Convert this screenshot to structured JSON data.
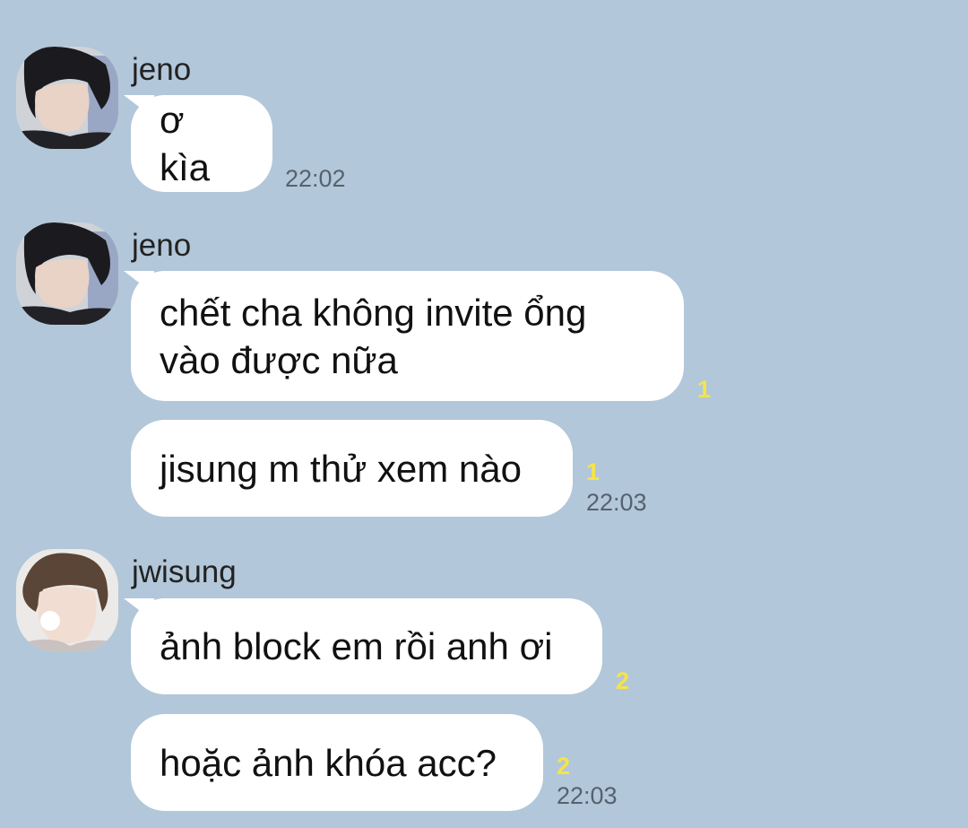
{
  "colors": {
    "chat_background": "#b2c7d9",
    "bubble": "#ffffff",
    "unread_count": "#f6e34a",
    "timestamp": "#556270"
  },
  "messages": [
    {
      "sender": "jeno",
      "text": "ơ kìa",
      "time": "22:02",
      "unread": ""
    },
    {
      "sender": "jeno",
      "text": "chết cha không invite ổng\nvào được nữa",
      "time": "",
      "unread": "1"
    },
    {
      "sender": "",
      "text": "jisung m thử xem nào",
      "time": "22:03",
      "unread": "1"
    },
    {
      "sender": "jwisung",
      "text": "ảnh block em rồi anh ơi",
      "time": "",
      "unread": "2"
    },
    {
      "sender": "",
      "text": "hoặc ảnh khóa acc?",
      "time": "22:03",
      "unread": "2"
    }
  ],
  "avatars": [
    {
      "icon": "profile-photo-dark-hair-icon"
    },
    {
      "icon": "profile-photo-dark-hair-icon"
    },
    {
      "icon": "profile-photo-light-background-icon"
    }
  ]
}
